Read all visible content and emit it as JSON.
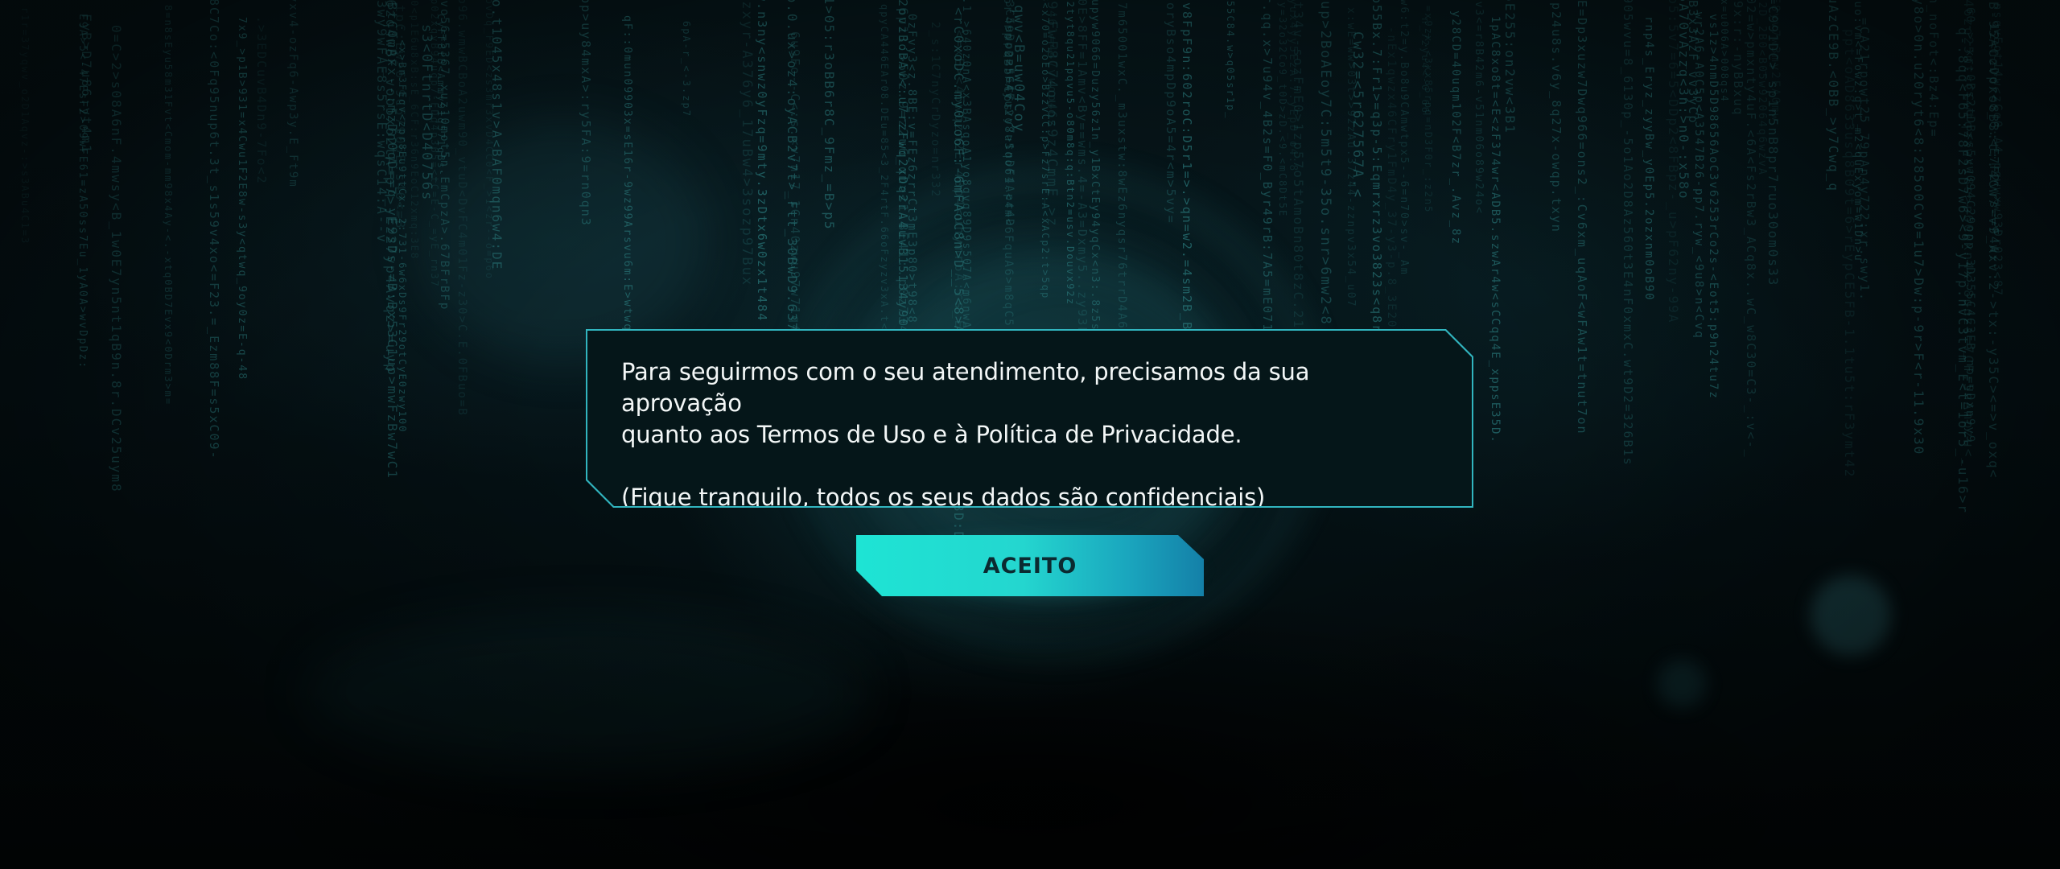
{
  "dialog": {
    "line1": "Para seguirmos com o seu atendimento, precisamos da sua aprovação",
    "line2": "quanto aos Termos de Uso e à Política de Privacidade.",
    "line3": "(Fique tranquilo, todos os seus dados são confidenciais)"
  },
  "actions": {
    "accept_label": "ACEITO"
  },
  "colors": {
    "accent": "#1ee4d4",
    "accent_dark": "#1480a8",
    "border": "#31b5bf",
    "background": "#020a0c",
    "text": "#f3f7f7"
  },
  "background": {
    "icon": "matrix-rain-network-background"
  }
}
